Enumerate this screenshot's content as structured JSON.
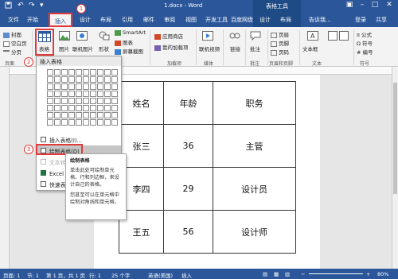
{
  "titlebar": {
    "title": "1.docx - Word",
    "context_tab": "表格工具",
    "quick_access": [
      "save-icon",
      "undo-icon",
      "redo-icon",
      "customize-icon"
    ]
  },
  "tabs": [
    {
      "label": "文件"
    },
    {
      "label": "开始"
    },
    {
      "label": "插入"
    },
    {
      "label": "设计"
    },
    {
      "label": "布局"
    },
    {
      "label": "引用"
    },
    {
      "label": "邮件"
    },
    {
      "label": "审阅"
    },
    {
      "label": "视图"
    },
    {
      "label": "开发工具"
    },
    {
      "label": "百度网盘"
    },
    {
      "label": "设计"
    },
    {
      "label": "布局"
    },
    {
      "label": "告诉我..."
    },
    {
      "label": "登录"
    },
    {
      "label": "共享"
    }
  ],
  "annotations": {
    "step1": "1",
    "step2": "2",
    "step3": "3"
  },
  "ribbon": {
    "cover": "封面",
    "blank": "空白页",
    "pagebreak": "分页",
    "pages_group": "页面",
    "table_btn": "表格",
    "picture": "图片",
    "online_picture": "联机图片",
    "shapes": "形状",
    "smartart": "SmartArt",
    "chart": "图表",
    "screenshot": "屏幕截图",
    "app_store": "应用商店",
    "my_addins": "我的加载项",
    "addins_group": "加载项",
    "online_video": "联机视频",
    "media_group": "媒体",
    "link": "链接",
    "comment": "批注",
    "comment_group": "批注",
    "header": "页眉",
    "footer": "页脚",
    "page_number": "页码",
    "hf_group": "页眉和页脚",
    "textbox": "文本框",
    "text_group": "文本",
    "formula": "公式",
    "symbol": "符号",
    "number": "编号",
    "symbol_group": "符号"
  },
  "dropdown": {
    "header": "插入表格",
    "insert_table": "插入表格(I)...",
    "draw_table": "绘制表格(D)",
    "text_to_table": "文本转换成表格(V)...",
    "excel": "Excel 电子表格(X)",
    "quick_tables": "快速表格(T)"
  },
  "tooltip": {
    "title": "绘制表格",
    "para1": "单击此处可绘制单元格、行和列边框，来设计自己的表格。",
    "para2": "您甚至可以在单元格中绘制对角线和单元格。"
  },
  "table": {
    "rows": [
      [
        "姓名",
        "年龄",
        "职务"
      ],
      [
        "张三",
        "36",
        "主管"
      ],
      [
        "李四",
        "29",
        "设计员"
      ],
      [
        "王五",
        "56",
        "设计师"
      ]
    ]
  },
  "statusbar": {
    "page": "页面: 1",
    "section": "节: 1",
    "pages": "第 1 页，共 1 页",
    "line": "行: 1",
    "words": "25 个字",
    "lang": "英语(美国)",
    "mode": "插入",
    "zoom": "80%"
  },
  "colors": {
    "word_blue": "#2b579a",
    "highlight_red": "#e23a3a",
    "ribbon_bg": "#f3f3f3"
  }
}
